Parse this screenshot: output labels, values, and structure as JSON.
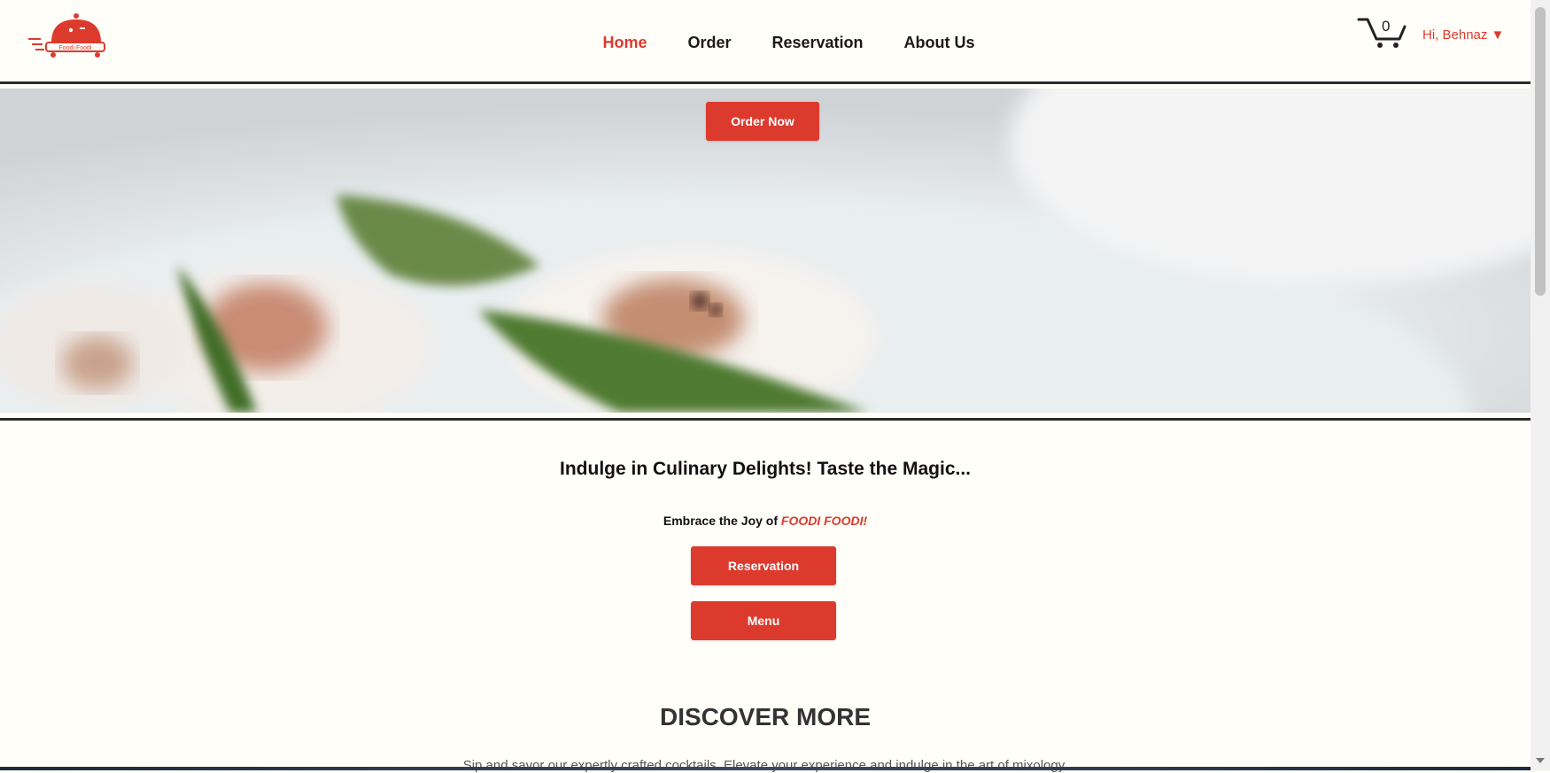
{
  "header": {
    "logo_text": "Foodi Foodi",
    "nav": [
      {
        "label": "Home",
        "active": true
      },
      {
        "label": "Order",
        "active": false
      },
      {
        "label": "Reservation",
        "active": false
      },
      {
        "label": "About Us",
        "active": false
      }
    ],
    "cart_count": "0",
    "user_greeting": "Hi, Behnaz",
    "user_caret": "▼"
  },
  "hero": {
    "order_button": "Order Now"
  },
  "content": {
    "tagline": "Indulge in Culinary Delights! Taste the Magic...",
    "sub_prefix": "Embrace the Joy of ",
    "sub_brand": "FOODI FOODI!",
    "reservation_button": "Reservation",
    "menu_button": "Menu",
    "discover_heading": "DISCOVER MORE",
    "discover_text": "Sip and savor our expertly crafted cocktails. Elevate your experience and indulge in the art of mixology."
  },
  "colors": {
    "accent": "#dd3a2e",
    "text": "#111111",
    "background": "#fffef9"
  },
  "icons": {
    "logo": "delivery-cloche-logo",
    "cart": "shopping-cart-icon",
    "caret": "caret-down-icon"
  }
}
